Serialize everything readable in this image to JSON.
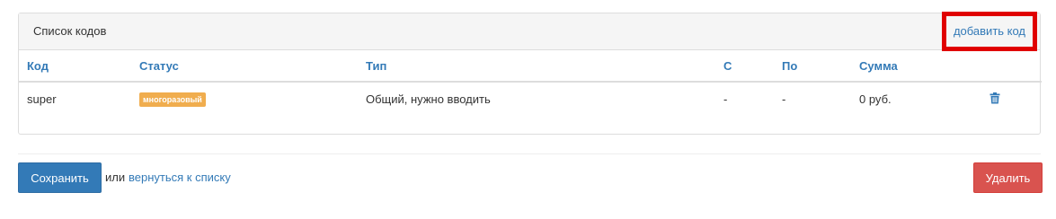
{
  "panel": {
    "title": "Список кодов",
    "add_code_link": "добавить код",
    "highlight_color": "#e00000"
  },
  "table": {
    "columns": [
      "Код",
      "Статус",
      "Тип",
      "С",
      "По",
      "Сумма"
    ],
    "rows": [
      {
        "code": "super",
        "status": "многоразовый",
        "type": "Общий, нужно вводить",
        "from": "-",
        "to": "-",
        "amount": "0 руб.",
        "action_icon": "trash-icon"
      }
    ]
  },
  "footer": {
    "save_label": "Сохранить",
    "or_text": "или",
    "back_link": "вернуться к списку",
    "delete_label": "Удалить"
  },
  "colors": {
    "primary": "#337ab7",
    "danger": "#d9534f",
    "warning_badge": "#f0ad4e"
  }
}
